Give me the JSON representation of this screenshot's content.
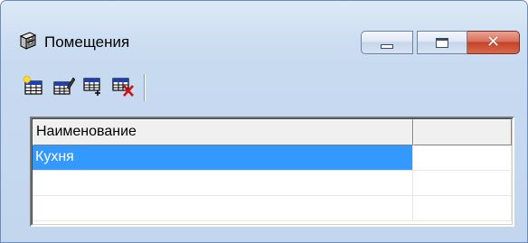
{
  "window": {
    "title": "Помещения",
    "icon": "cabinet-icon",
    "buttons": {
      "minimize": "minimize-icon",
      "maximize": "maximize-icon",
      "close": "close-icon",
      "close_glyph": "✕"
    }
  },
  "toolbar": {
    "buttons": [
      {
        "name": "add-record-button",
        "icon": "add-record-icon"
      },
      {
        "name": "edit-record-button",
        "icon": "edit-record-icon"
      },
      {
        "name": "copy-record-button",
        "icon": "copy-record-icon"
      },
      {
        "name": "delete-record-button",
        "icon": "delete-record-icon"
      }
    ]
  },
  "grid": {
    "columns": [
      "Наименование",
      ""
    ],
    "rows": [
      {
        "name": "Кухня",
        "selected": true
      },
      {
        "name": "",
        "selected": false
      },
      {
        "name": "",
        "selected": false
      }
    ],
    "colors": {
      "selection": "#3399ff",
      "selection_text": "#ffffff"
    }
  },
  "colors": {
    "frame": "#c2d6ee",
    "close_button": "#c4432a"
  }
}
